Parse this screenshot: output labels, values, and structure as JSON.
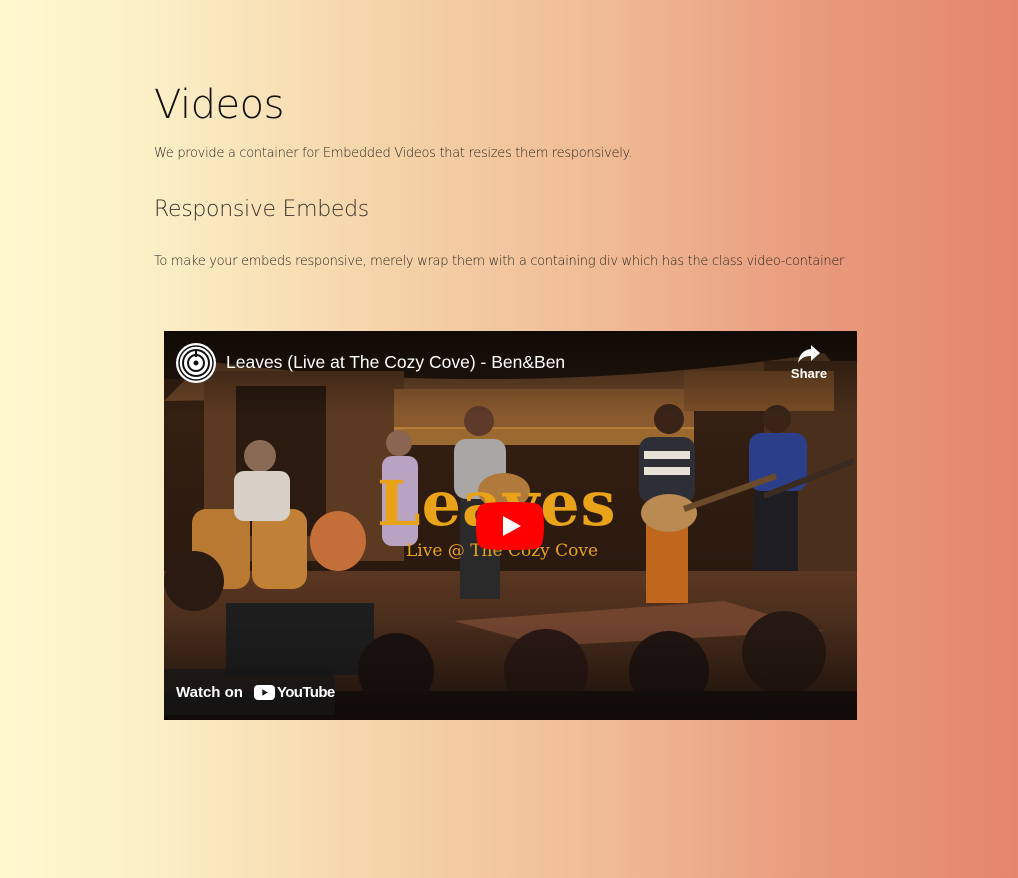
{
  "page": {
    "title": "Videos",
    "intro": "We provide a container for Embedded Videos that resizes them responsively."
  },
  "section": {
    "title": "Responsive Embeds",
    "text": "To make your embeds responsive, merely wrap them with a containing div which has the class video-container"
  },
  "video": {
    "title": "Leaves (Live at The Cozy Cove) - Ben&Ben",
    "share_label": "Share",
    "overlay_title": "Leaves",
    "overlay_subtitle": "Live @ The Cozy Cove",
    "watch_label": "Watch on",
    "platform_name": "YouTube"
  },
  "icons": {
    "channel": "channel-avatar-icon",
    "share": "share-icon",
    "play": "play-icon",
    "youtube": "youtube-logo-icon"
  },
  "colors": {
    "play_button": "#ff0000",
    "overlay_text": "#e9a318",
    "gradient_left": "#fff8cf",
    "gradient_right": "#e4866c"
  }
}
